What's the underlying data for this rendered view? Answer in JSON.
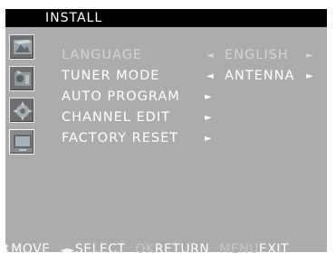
{
  "title": "INSTALL",
  "icons": [
    "picture-icon",
    "audio-icon",
    "setup-icon",
    "install-icon"
  ],
  "menu": [
    {
      "label": "LANGUAGE",
      "value": "ENGLISH",
      "left": "◄",
      "right": "►",
      "dim": true
    },
    {
      "label": "TUNER MODE",
      "value": "ANTENNA",
      "left": "◄",
      "right": "►"
    },
    {
      "label": "AUTO PROGRAM",
      "submenu": "►"
    },
    {
      "label": "CHANNEL EDIT",
      "submenu": "►"
    },
    {
      "label": "FACTORY RESET",
      "submenu": "►"
    }
  ],
  "footer": {
    "move_key": "⬍",
    "move_label": "MOVE",
    "select_key": "◄►",
    "select_label": "SELECT",
    "ok_key": "OK",
    "return_label": "RETURN",
    "menu_key": "MENU",
    "exit_label": "EXIT"
  }
}
